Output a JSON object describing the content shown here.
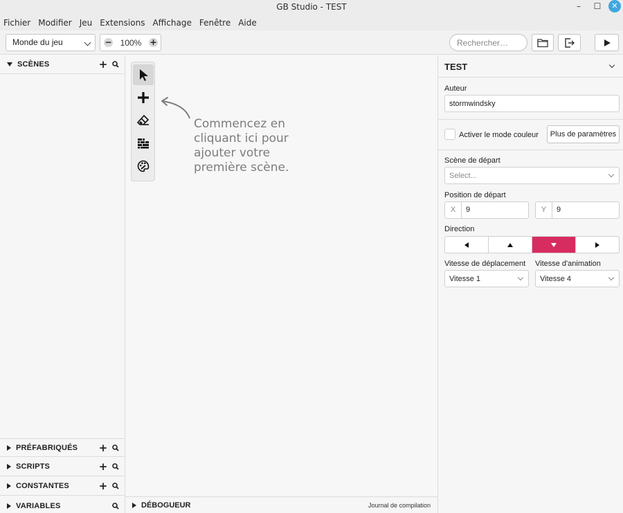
{
  "window": {
    "title": "GB Studio - TEST",
    "minimize": "–",
    "maximize": "☐",
    "close": "✕"
  },
  "menu": [
    "Fichier",
    "Modifier",
    "Jeu",
    "Extensions",
    "Affichage",
    "Fenêtre",
    "Aide"
  ],
  "toolbar": {
    "view_select": "Monde du jeu",
    "zoom": "100%",
    "zoom_out": "−",
    "zoom_in": "+",
    "search_placeholder": "Rechercher…"
  },
  "sidebar": {
    "scenes": "SCÈNES",
    "prefabs": "PRÉFABRIQUÉS",
    "scripts": "SCRIPTS",
    "constants": "CONSTANTES",
    "variables": "VARIABLES"
  },
  "canvas": {
    "hint": "Commencez en cliquant ici pour ajouter votre première scène."
  },
  "debug": {
    "label": "DÉBOGUEUR",
    "log": "Journal de compilation"
  },
  "properties": {
    "title": "TEST",
    "author_label": "Auteur",
    "author_value": "stormwindsky",
    "color_mode_label": "Activer le mode couleur",
    "color_mode_checked": false,
    "more_settings": "Plus de paramètres",
    "start_scene_label": "Scène de départ",
    "start_scene_placeholder": "Select...",
    "start_position_label": "Position de départ",
    "x_label": "X",
    "x_value": "9",
    "y_label": "Y",
    "y_value": "9",
    "direction_label": "Direction",
    "direction_selected": "down",
    "move_speed_label": "Vitesse de déplacement",
    "move_speed_value": "Vitesse 1",
    "anim_speed_label": "Vitesse d'animation",
    "anim_speed_value": "Vitesse 4"
  },
  "colors": {
    "accent": "#d72c60",
    "close_button": "#3fa7e0"
  }
}
